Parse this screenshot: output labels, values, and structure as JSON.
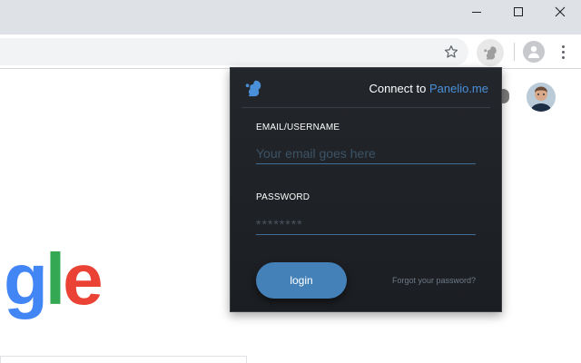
{
  "window": {
    "controls": [
      "minimize",
      "maximize",
      "close"
    ]
  },
  "toolbar": {
    "icons": {
      "bookmark": "star-icon",
      "extension": "squirrel-icon",
      "profile": "person-icon",
      "menu": "kebab-menu-icon"
    }
  },
  "page": {
    "logo_fragment": [
      "g",
      "l",
      "e"
    ],
    "logo_colors": [
      "#4285f4",
      "#34a853",
      "#ea4335"
    ]
  },
  "popup": {
    "connect_prefix": "Connect to ",
    "connect_link": "Panelio.me",
    "email_label": "EMAIL/USERNAME",
    "email_placeholder": "Your email goes here",
    "password_label": "PASSWORD",
    "password_placeholder": "********",
    "login_label": "login",
    "forgot_label": "Forgot your password?",
    "accent_color": "#4a90d9",
    "button_color": "#4581b9"
  }
}
